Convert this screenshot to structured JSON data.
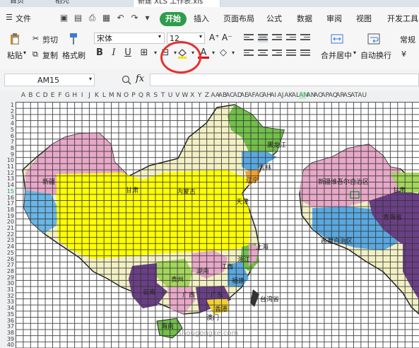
{
  "tabs": {
    "home": "首页",
    "app": "稻壳",
    "doc": "新建 XLS 工作表.xls"
  },
  "menu": {
    "file": "文件",
    "items": [
      "开始",
      "插入",
      "页面布局",
      "公式",
      "数据",
      "审阅",
      "视图",
      "开发工具"
    ]
  },
  "ribbon": {
    "paste": "粘贴",
    "cut": "剪切",
    "copy": "复制",
    "format_painter": "格式刷",
    "font_name": "宋体",
    "font_size": "12",
    "bold": "B",
    "italic": "I",
    "underline": "U",
    "merge_center": "合并居中",
    "wrap_text": "自动换行",
    "number_format": "常规",
    "currency": "¥"
  },
  "formula": {
    "cell_ref": "AM15",
    "fx": "fx",
    "value": ""
  },
  "columns": [
    "A",
    "B",
    "C",
    "D",
    "E",
    "F",
    "G",
    "H",
    "I",
    "J",
    "K",
    "L",
    "M",
    "N",
    "O",
    "P",
    "Q",
    "R",
    "S",
    "T",
    "U",
    "V",
    "W",
    "X",
    "Y",
    "Z",
    "AA",
    "AB",
    "AC",
    "AD",
    "AE",
    "AF",
    "AG",
    "AH",
    "AI",
    "AJ",
    "AK",
    "AL",
    "AM",
    "AN",
    "AO",
    "AP",
    "AQ",
    "AR",
    "AS",
    "AT",
    "AU"
  ],
  "rows": [
    "1",
    "2",
    "3",
    "4",
    "5",
    "6",
    "7",
    "8",
    "9",
    "10",
    "11",
    "12",
    "13",
    "14",
    "15",
    "16",
    "17",
    "18",
    "19",
    "20",
    "21",
    "22",
    "23",
    "24",
    "25",
    "26",
    "27",
    "28",
    "29",
    "30",
    "31",
    "32",
    "33",
    "34",
    "35",
    "36",
    "37",
    "38",
    "39",
    "40"
  ],
  "map_labels": {
    "heilongjiang": "黑龙江",
    "jilin": "吉林",
    "liaoning": "辽宁",
    "xinjiang": "新疆",
    "gansu": "甘肃",
    "neimenggu": "内蒙古",
    "tianjin": "天津",
    "shanghai": "上海",
    "zhejiang": "浙江",
    "jiangxi": "江西",
    "hunan": "湖南",
    "guizhou": "贵州",
    "fujian": "福建",
    "yunnan": "云南",
    "guangxi": "广西",
    "guangdong": "广东",
    "hongkong": "香港",
    "taiwan": "台湾省",
    "hainan": "海南",
    "aomen": "澳门",
    "xinjiang_full": "新疆维吾尔自治区",
    "gansu2": "甘肃",
    "qinghai": "青海省",
    "xizang": "西藏自治区"
  },
  "watermark": "shougongke.com",
  "colors": {
    "accent": "#2e9c4d",
    "highlight": "#e53030",
    "fill": "#ffff00"
  }
}
